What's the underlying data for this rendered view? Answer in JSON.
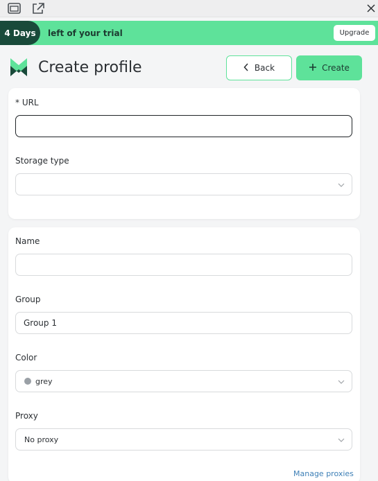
{
  "banner": {
    "days": "4 Days",
    "text": "left of your trial",
    "upgrade_label": "Upgrade"
  },
  "header": {
    "title": "Create profile",
    "back_label": "Back",
    "create_label": "Create"
  },
  "form": {
    "url": {
      "label": "* URL",
      "value": ""
    },
    "storage_type": {
      "label": "Storage type",
      "value": ""
    },
    "name": {
      "label": "Name",
      "value": ""
    },
    "group": {
      "label": "Group",
      "value": "Group 1"
    },
    "color": {
      "label": "Color",
      "value": "grey",
      "swatch": "#9aa0a6"
    },
    "proxy": {
      "label": "Proxy",
      "value": "No proxy"
    },
    "manage_proxies_label": "Manage proxies"
  },
  "colors": {
    "accent": "#5ee29a",
    "days_pill": "#194a3a",
    "link": "#3d7fb6"
  }
}
